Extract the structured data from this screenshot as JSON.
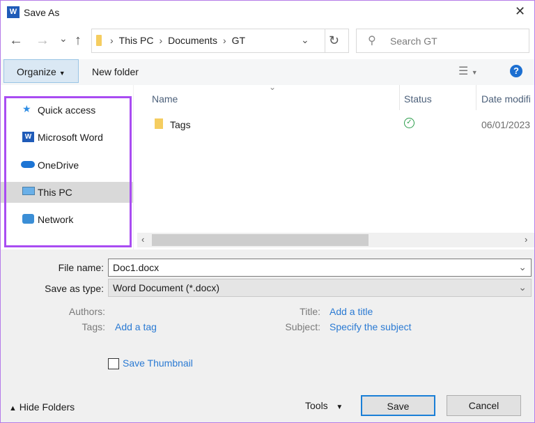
{
  "window": {
    "title": "Save As",
    "close": "✕"
  },
  "nav": {
    "back": "←",
    "forward": "→",
    "recent": "⌄",
    "up": "↑",
    "refresh": "↻"
  },
  "address": {
    "path": [
      "This PC",
      "Documents",
      "GT"
    ]
  },
  "search": {
    "placeholder": "Search GT"
  },
  "toolbar": {
    "organize": "Organize",
    "new_folder": "New folder",
    "help": "?"
  },
  "sidebar": {
    "items": [
      {
        "label": "Quick access"
      },
      {
        "label": "Microsoft Word"
      },
      {
        "label": "OneDrive"
      },
      {
        "label": "This PC"
      },
      {
        "label": "Network"
      }
    ]
  },
  "columns": {
    "name": "Name",
    "status": "Status",
    "date": "Date modifi"
  },
  "files": [
    {
      "name": "Tags",
      "date": "06/01/2023"
    }
  ],
  "form": {
    "file_name_label": "File name:",
    "file_name": "Doc1.docx",
    "type_label": "Save as type:",
    "type": "Word Document (*.docx)",
    "authors_label": "Authors:",
    "tags_label": "Tags:",
    "tags_link": "Add a tag",
    "title_label": "Title:",
    "title_link": "Add a title",
    "subject_label": "Subject:",
    "subject_link": "Specify the subject",
    "thumbnail": "Save Thumbnail"
  },
  "footer": {
    "hide_folders": "Hide Folders",
    "tools": "Tools",
    "save": "Save",
    "cancel": "Cancel"
  },
  "colors": {
    "highlight": "#a94cf2",
    "link": "#2a7ad3",
    "selected": "#d9d9d9"
  }
}
